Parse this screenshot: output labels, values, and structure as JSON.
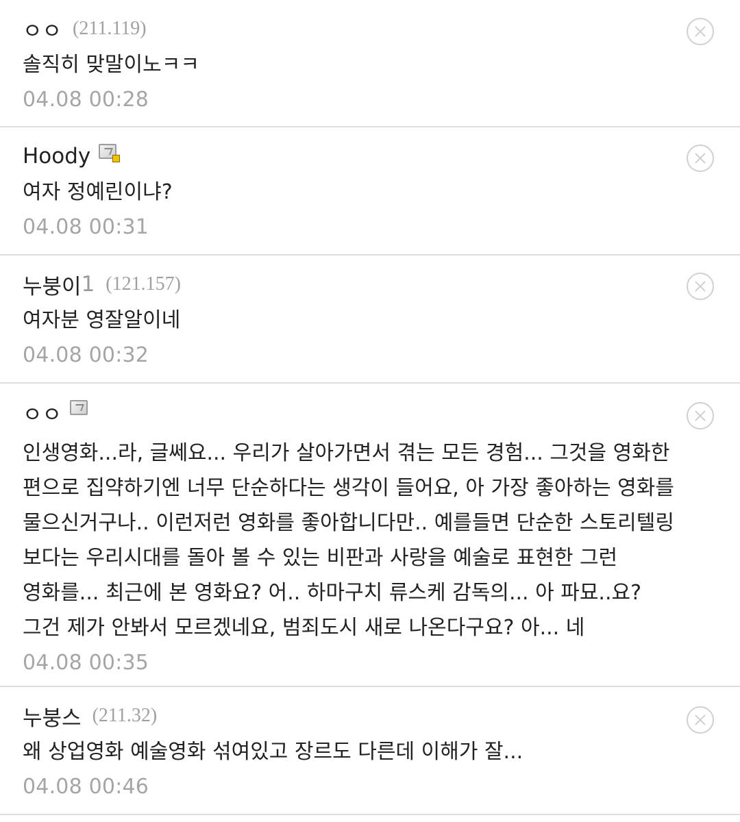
{
  "comments": [
    {
      "nickname": "ㅇㅇ",
      "nickname_suffix": "",
      "ip": "(211.119)",
      "text": "솔직히 맞말이노ㅋㅋ",
      "date": "04.08 00:28"
    },
    {
      "nickname": "Hoody",
      "nickname_suffix": "",
      "icon": "gallog-icon-with-badge",
      "text": "여자 정예린이냐?",
      "date": "04.08 00:31"
    },
    {
      "nickname": "누붕이",
      "nickname_suffix": "1",
      "ip": "(121.157)",
      "text": "여자분 영잘알이네",
      "date": "04.08 00:32"
    },
    {
      "nickname": "ㅇㅇ",
      "nickname_suffix": "",
      "icon": "gallog-icon",
      "text": "인생영화...라, 글쎄요... 우리가 살아가면서 겪는 모든 경험... 그것을 영화한 편으로 집약하기엔 너무 단순하다는 생각이 들어요, 아 가장 좋아하는 영화를 물으신거구나.. 이런저런 영화를 좋아합니다만.. 예를들면 단순한 스토리텔링 보다는 우리시대를 돌아 볼 수 있는 비판과 사랑을 예술로 표현한 그런 영화를... 최근에 본 영화요? 어.. 하마구치 류스케 감독의... 아 파묘..요? 그건 제가 안봐서 모르겠네요, 범죄도시 새로 나온다구요? 아... 네",
      "date": "04.08 00:35"
    },
    {
      "nickname": "누붕스",
      "nickname_suffix": "",
      "ip": "(211.32)",
      "text": "왜 상업영화 예술영화 섞여있고 장르도 다른데 이해가 잘...",
      "date": "04.08 00:46"
    }
  ],
  "icons": {
    "delete": "close-circle-icon",
    "gallog": "gallog-icon"
  },
  "colors": {
    "text": "#222222",
    "muted": "#a5a5a5",
    "divider": "#dedede",
    "badge": "#f2c200"
  }
}
